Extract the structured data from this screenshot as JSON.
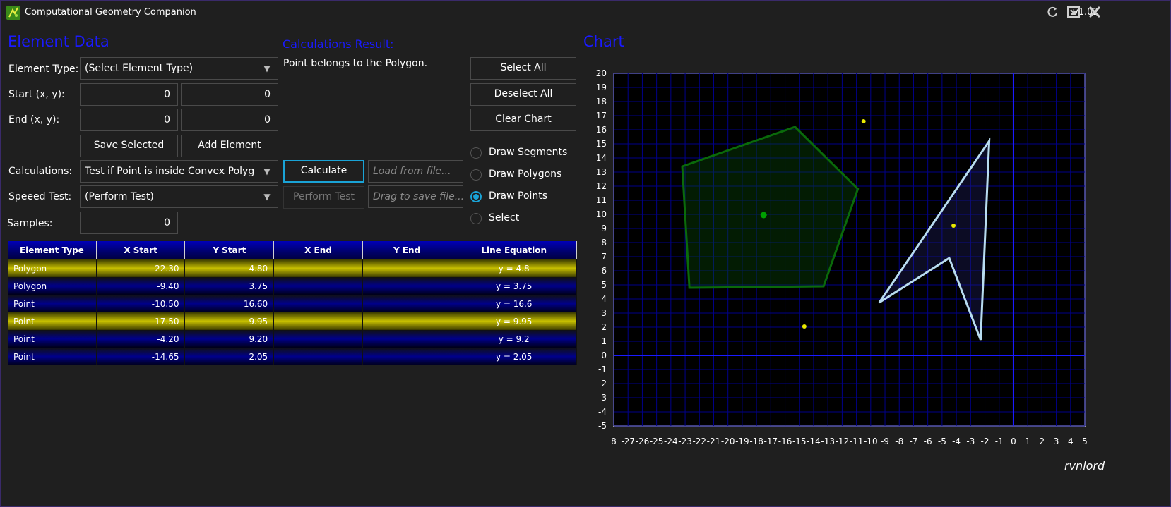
{
  "window": {
    "title": "Computational Geometry Companion",
    "version": "v1.02"
  },
  "element_data": {
    "header": "Element Data",
    "element_type_label": "Element Type:",
    "element_type_value": "(Select Element Type)",
    "start_label": "Start (x, y):",
    "start_x": "0",
    "start_y": "0",
    "end_label": "End (x, y):",
    "end_x": "0",
    "end_y": "0",
    "save_selected": "Save Selected",
    "add_element": "Add Element",
    "calculations_label": "Calculations:",
    "calculations_value": "Test if Point is inside Convex Polygc",
    "speed_test_label": "Speeed Test:",
    "speed_test_value": "(Perform Test)",
    "samples_label": "Samples:",
    "samples_value": "0"
  },
  "results": {
    "header": "Calculations Result:",
    "text": "Point belongs to the Polygon.",
    "calculate": "Calculate",
    "perform_test": "Perform Test",
    "load_placeholder": "Load from file...",
    "save_placeholder": "Drag to save file..."
  },
  "chart_controls": {
    "select_all": "Select All",
    "deselect_all": "Deselect All",
    "clear_chart": "Clear Chart",
    "modes": [
      {
        "label": "Draw Segments",
        "selected": false
      },
      {
        "label": "Draw Polygons",
        "selected": false
      },
      {
        "label": "Draw Points",
        "selected": true
      },
      {
        "label": "Select",
        "selected": false
      }
    ]
  },
  "table": {
    "columns": [
      "Element Type",
      "X Start",
      "Y Start",
      "X End",
      "Y End",
      "Line Equation"
    ],
    "rows": [
      {
        "type": "Polygon",
        "x_start": "-22.30",
        "y_start": "4.80",
        "x_end": "",
        "y_end": "",
        "equation": "y = 4.8",
        "selected": true
      },
      {
        "type": "Polygon",
        "x_start": "-9.40",
        "y_start": "3.75",
        "x_end": "",
        "y_end": "",
        "equation": "y = 3.75",
        "selected": false
      },
      {
        "type": "Point",
        "x_start": "-10.50",
        "y_start": "16.60",
        "x_end": "",
        "y_end": "",
        "equation": "y = 16.6",
        "selected": false
      },
      {
        "type": "Point",
        "x_start": "-17.50",
        "y_start": "9.95",
        "x_end": "",
        "y_end": "",
        "equation": "y = 9.95",
        "selected": true
      },
      {
        "type": "Point",
        "x_start": "-4.20",
        "y_start": "9.20",
        "x_end": "",
        "y_end": "",
        "equation": "y = 9.2",
        "selected": false
      },
      {
        "type": "Point",
        "x_start": "-14.65",
        "y_start": "2.05",
        "x_end": "",
        "y_end": "",
        "equation": "y = 2.05",
        "selected": false
      }
    ]
  },
  "chart": {
    "header": "Chart",
    "colors": {
      "grid": "#00008a",
      "axis": "#1a1aff",
      "polygon1": "#0a6a0a",
      "polygon2": "#b8dcf0",
      "point": "#e8e800",
      "selected_point": "#00a000"
    }
  },
  "chart_data": {
    "type": "scatter",
    "xlim": [
      -28,
      5
    ],
    "ylim": [
      -5,
      20
    ],
    "x_ticks": [
      "8",
      "-27",
      "-26",
      "-25",
      "-24",
      "-23",
      "-22",
      "-21",
      "-20",
      "-19",
      "-18",
      "-17",
      "-16",
      "-15",
      "-14",
      "-13",
      "-12",
      "-11",
      "-10",
      "-9",
      "-8",
      "-7",
      "-6",
      "-5",
      "-4",
      "-3",
      "-2",
      "-1",
      "0",
      "1",
      "2",
      "3",
      "4",
      "5"
    ],
    "y_ticks": [
      "20",
      "19",
      "18",
      "17",
      "16",
      "15",
      "14",
      "13",
      "12",
      "11",
      "10",
      "9",
      "8",
      "7",
      "6",
      "5",
      "4",
      "3",
      "2",
      "1",
      "0",
      "-1",
      "-2",
      "-3",
      "-4",
      "-5"
    ],
    "grid": true,
    "polygons": [
      {
        "selected": true,
        "vertices": [
          [
            -23.2,
            13.4
          ],
          [
            -15.3,
            16.2
          ],
          [
            -10.9,
            11.8
          ],
          [
            -13.3,
            4.9
          ],
          [
            -22.7,
            4.8
          ]
        ]
      },
      {
        "selected": false,
        "vertices": [
          [
            -1.7,
            15.2
          ],
          [
            -2.3,
            1.1
          ],
          [
            -4.5,
            6.9
          ],
          [
            -9.4,
            3.75
          ]
        ]
      }
    ],
    "points": [
      {
        "x": -10.5,
        "y": 16.6,
        "selected": false
      },
      {
        "x": -17.5,
        "y": 9.95,
        "selected": true
      },
      {
        "x": -4.2,
        "y": 9.2,
        "selected": false
      },
      {
        "x": -14.65,
        "y": 2.05,
        "selected": false
      }
    ]
  },
  "footer": {
    "author": "rvnlord"
  }
}
